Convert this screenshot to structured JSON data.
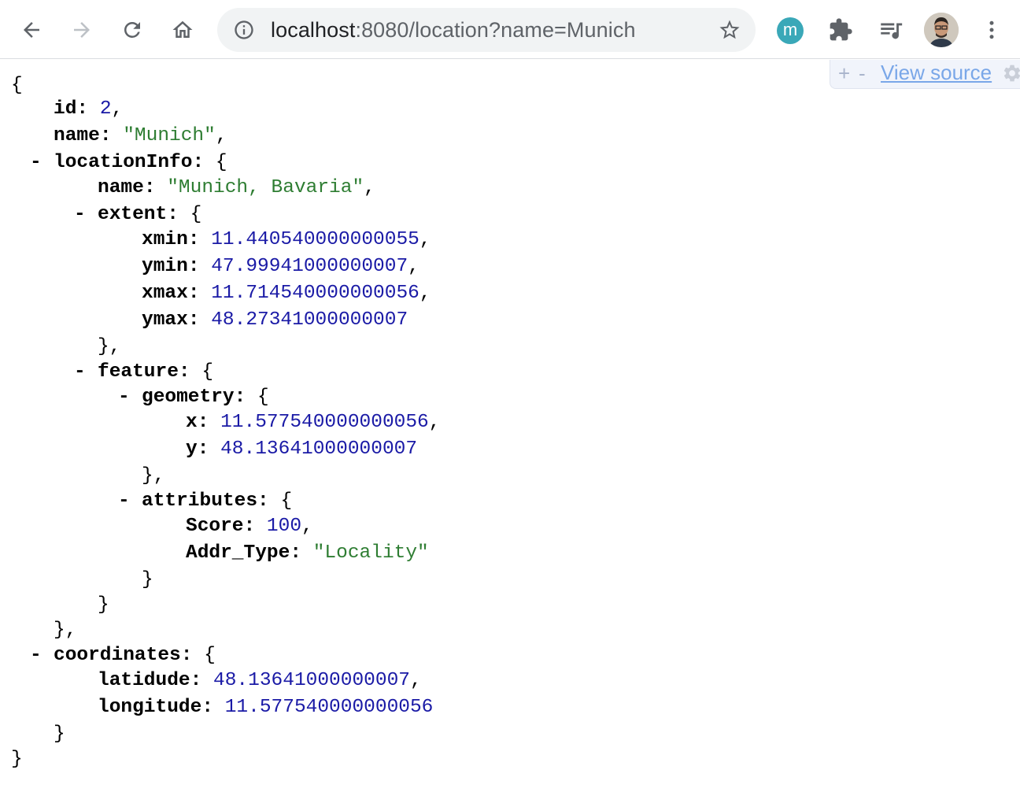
{
  "browser": {
    "url": "localhost:8080/location?name=Munich",
    "url_host": "localhost",
    "url_rest": ":8080/location?name=Munich",
    "extension_letter": "m",
    "icons": [
      "back-icon",
      "forward-icon",
      "reload-icon",
      "home-icon",
      "site-info-icon",
      "bookmark-star-icon",
      "extensions-puzzle-icon",
      "media-queue-icon",
      "profile-avatar",
      "kebab-menu-icon"
    ]
  },
  "viewer": {
    "expand_all": "+",
    "collapse_all": "-",
    "view_source": "View source"
  },
  "json": {
    "brace_open": "{",
    "brace_close": "}",
    "id_key": "id",
    "id_value": "2",
    "name_key": "name",
    "name_value": "\"Munich\"",
    "locationInfo_key": "locationInfo",
    "li_name_key": "name",
    "li_name_value": "\"Munich, Bavaria\"",
    "extent_key": "extent",
    "xmin_key": "xmin",
    "xmin_value": "11.440540000000055",
    "ymin_key": "ymin",
    "ymin_value": "47.99941000000007",
    "xmax_key": "xmax",
    "xmax_value": "11.714540000000056",
    "ymax_key": "ymax",
    "ymax_value": "48.27341000000007",
    "feature_key": "feature",
    "geometry_key": "geometry",
    "x_key": "x",
    "x_value": "11.577540000000056",
    "y_key": "y",
    "y_value": "48.13641000000007",
    "attributes_key": "attributes",
    "score_key": "Score",
    "score_value": "100",
    "addr_type_key": "Addr_Type",
    "addr_type_value": "\"Locality\"",
    "coordinates_key": "coordinates",
    "latitude_key": "latidude",
    "latitude_value": "48.13641000000007",
    "longitude_key": "longitude",
    "longitude_value": "11.577540000000056"
  },
  "colors": {
    "number": "#1a1aa6",
    "string": "#2e7d32",
    "link": "#7aa7e8"
  }
}
